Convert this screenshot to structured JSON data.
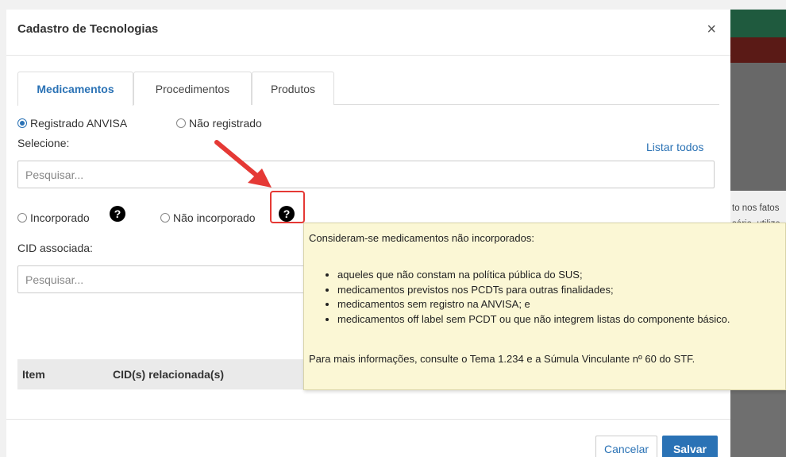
{
  "modal": {
    "title": "Cadastro de Tecnologias",
    "close_glyph": "×"
  },
  "tabs": [
    {
      "label": "Medicamentos",
      "active": true
    },
    {
      "label": "Procedimentos",
      "active": false
    },
    {
      "label": "Produtos",
      "active": false
    }
  ],
  "registration": {
    "option_registered": "Registrado ANVISA",
    "option_unregistered": "Não registrado",
    "selected": "Registrado ANVISA"
  },
  "select_label": "Selecione:",
  "list_all_link": "Listar todos",
  "search": {
    "placeholder": "Pesquisar..."
  },
  "incorporation": {
    "option_incorporated": "Incorporado",
    "option_not_incorporated": "Não incorporado",
    "help_glyph": "?"
  },
  "cid": {
    "label": "CID associada:",
    "placeholder": "Pesquisar..."
  },
  "table": {
    "columns": [
      "Item",
      "CID(s) relacionada(s)"
    ]
  },
  "tooltip": {
    "heading": "Consideram-se medicamentos não incorporados:",
    "items": [
      "aqueles que não constam na política pública do SUS;",
      "medicamentos previstos nos PCDTs para outras finalidades;",
      "medicamentos sem registro na ANVISA; e",
      "medicamentos off label sem PCDT ou que não integrem listas do componente básico."
    ],
    "footer": "Para mais informações, consulte o Tema 1.234 e a Súmula Vinculante nº 60 do STF."
  },
  "buttons": {
    "cancel": "Cancelar",
    "save": "Salvar"
  },
  "background_text": {
    "line1": "to nos fatos",
    "line2": "sário, utilize"
  },
  "colors": {
    "accent": "#2a72b5",
    "tooltip_bg": "#fbf7d5",
    "highlight": "#e53935"
  }
}
